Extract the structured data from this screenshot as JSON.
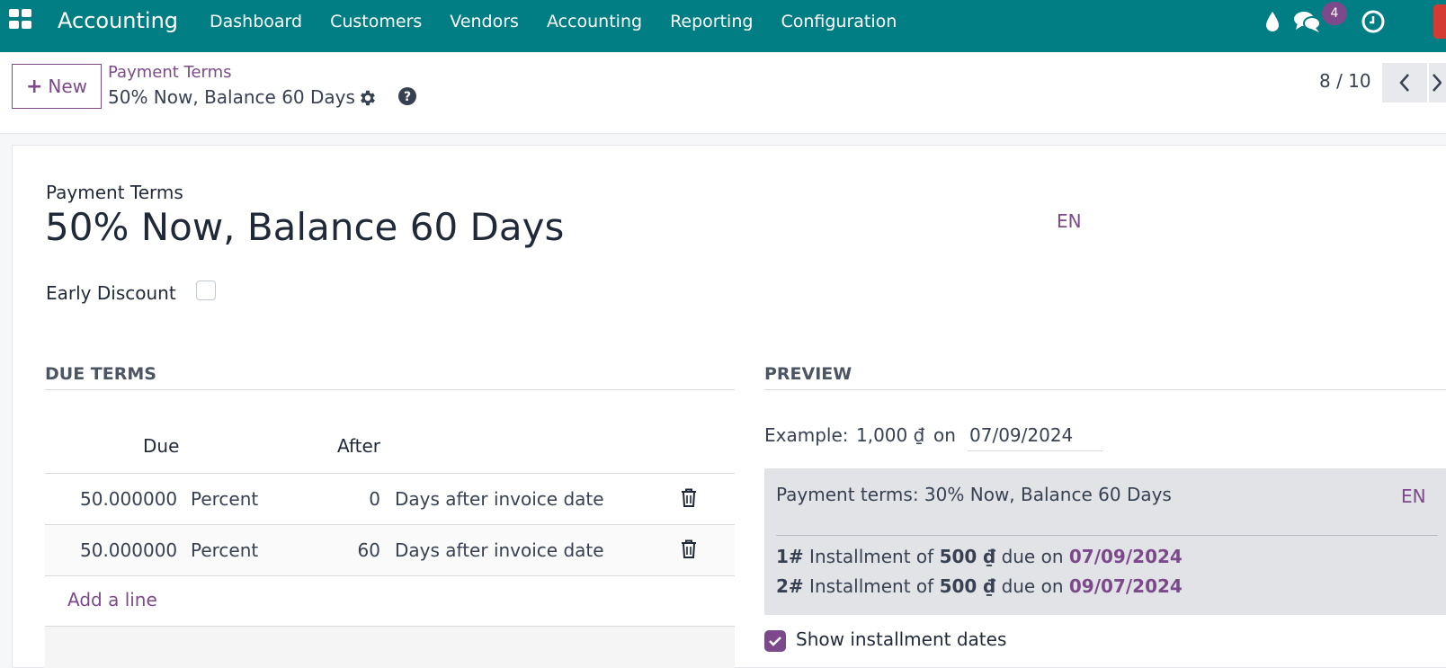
{
  "navbar": {
    "app_name": "Accounting",
    "menu": [
      "Dashboard",
      "Customers",
      "Vendors",
      "Accounting",
      "Reporting",
      "Configuration"
    ],
    "chat_count": "4",
    "color": "#017e84"
  },
  "control_panel": {
    "new_label": "New",
    "breadcrumb_parent": "Payment Terms",
    "breadcrumb_current": "50% Now, Balance 60 Days",
    "pager": "8 / 10"
  },
  "form": {
    "name_label": "Payment Terms",
    "name": "50% Now, Balance 60 Days",
    "lang": "EN",
    "early_discount_label": "Early Discount",
    "early_discount_checked": false
  },
  "due_terms": {
    "title": "DUE TERMS",
    "headers": {
      "due": "Due",
      "after": "After"
    },
    "rows": [
      {
        "value": "50.000000",
        "type": "Percent",
        "days": "0",
        "option": "Days after invoice date"
      },
      {
        "value": "50.000000",
        "type": "Percent",
        "days": "60",
        "option": "Days after invoice date"
      }
    ],
    "add_line": "Add a line"
  },
  "preview": {
    "title": "PREVIEW",
    "example_label": "Example:",
    "example_amount": "1,000 ₫",
    "example_on": "on",
    "example_date": "07/09/2024",
    "terms_text": "Payment terms: 30% Now, Balance 60 Days",
    "lang": "EN",
    "installments": [
      {
        "num": "1#",
        "text": "Installment of",
        "amount": "500 ₫",
        "due_text": "due on",
        "date": "07/09/2024"
      },
      {
        "num": "2#",
        "text": "Installment of",
        "amount": "500 ₫",
        "due_text": "due on",
        "date": "09/07/2024"
      }
    ],
    "show_dates_label": "Show installment dates",
    "show_dates_checked": true
  },
  "colors": {
    "brand": "#017e84",
    "accent": "#7c4a8a"
  }
}
